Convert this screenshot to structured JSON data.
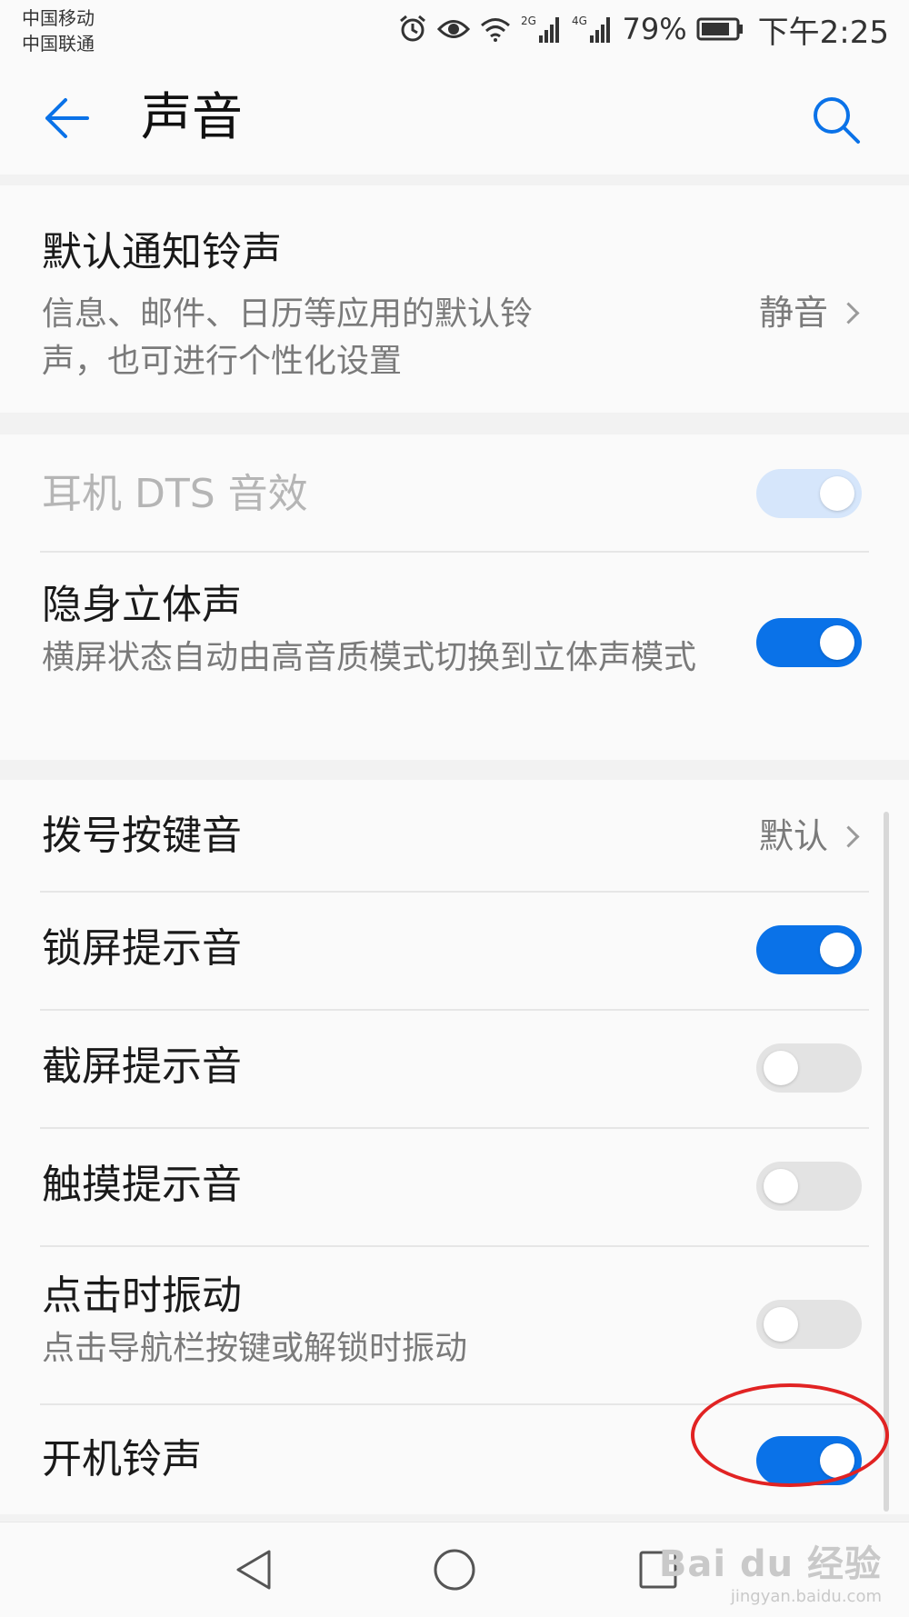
{
  "status_bar": {
    "carrier_1": "中国移动",
    "carrier_2": "中国联通",
    "network_1": "2G",
    "network_2": "4G",
    "battery": "79%",
    "time": "下午2:25",
    "icons": [
      "alarm-icon",
      "eye-icon",
      "wifi-icon",
      "signal-2g-icon",
      "signal-4g-icon",
      "battery-icon"
    ]
  },
  "app_bar": {
    "title": "声音",
    "back_icon": "arrow-left-icon",
    "search_icon": "search-icon"
  },
  "sections": {
    "notification": {
      "title": "默认通知铃声",
      "desc": "信息、邮件、日历等应用的默认铃声，也可进行个性化设置",
      "value": "静音"
    },
    "dts": {
      "title": "耳机 DTS 音效",
      "enabled": false,
      "on": true
    },
    "stereo": {
      "title": "隐身立体声",
      "desc": "横屏状态自动由高音质模式切换到立体声模式",
      "on": true
    },
    "dial_tone": {
      "title": "拨号按键音",
      "value": "默认"
    },
    "lock_sound": {
      "title": "锁屏提示音",
      "on": true
    },
    "screenshot_sound": {
      "title": "截屏提示音",
      "on": false
    },
    "touch_sound": {
      "title": "触摸提示音",
      "on": false
    },
    "tap_vibrate": {
      "title": "点击时振动",
      "desc": "点击导航栏按键或解锁时振动",
      "on": false
    },
    "boot_ringtone": {
      "title": "开机铃声",
      "on": true
    }
  },
  "nav_bar": {
    "back": "nav-back-icon",
    "home": "nav-home-icon",
    "recents": "nav-recents-icon"
  },
  "watermark": {
    "brand": "Bai du 经验",
    "url": "jingyan.baidu.com"
  },
  "colors": {
    "accent": "#0a72e8",
    "annotation": "#e12323"
  }
}
